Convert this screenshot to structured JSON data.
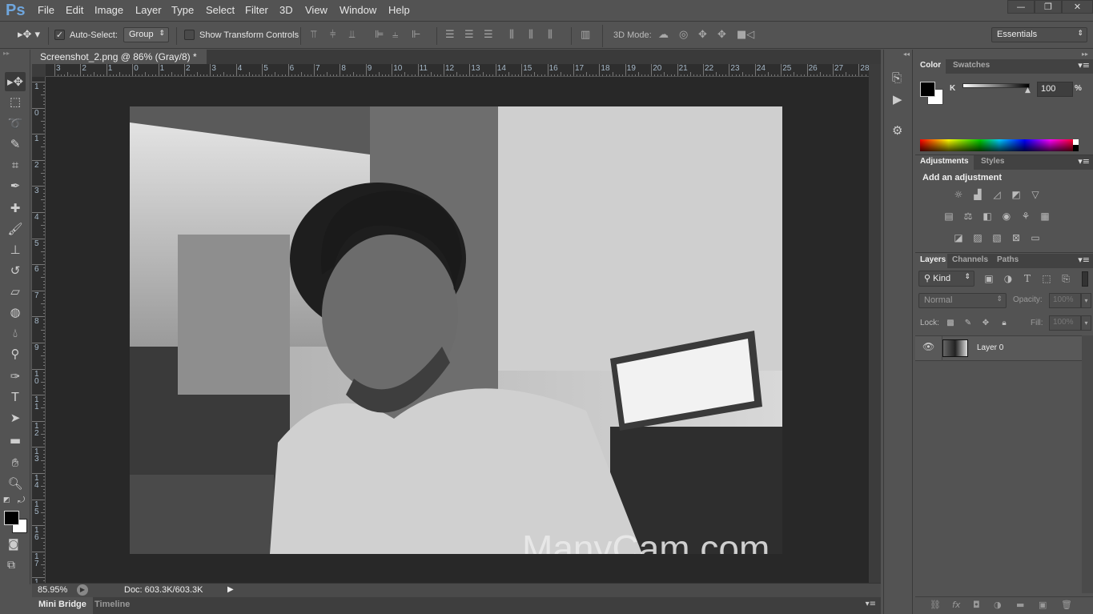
{
  "app": {
    "logo": "Ps"
  },
  "menu": [
    "File",
    "Edit",
    "Image",
    "Layer",
    "Type",
    "Select",
    "Filter",
    "3D",
    "View",
    "Window",
    "Help"
  ],
  "window_controls": {
    "minimize": "—",
    "restore": "❐",
    "close": "✕"
  },
  "options": {
    "auto_select_label": "Auto-Select:",
    "auto_select_checked": true,
    "auto_select_value": "Group",
    "transform_label": "Show Transform Controls",
    "transform_checked": false,
    "mode3d_label": "3D Mode:",
    "workspace": "Essentials"
  },
  "document": {
    "tab_title": "Screenshot_2.png @ 86% (Gray/8) *",
    "close": "×"
  },
  "rulers": {
    "top": [
      "3",
      "2",
      "1",
      "0",
      "1",
      "2",
      "3",
      "4",
      "5",
      "6",
      "7",
      "8",
      "9",
      "10",
      "11",
      "12",
      "13",
      "14",
      "15",
      "16",
      "17",
      "18",
      "19",
      "20",
      "21",
      "22",
      "23",
      "24",
      "25",
      "26",
      "27",
      "28"
    ],
    "left": [
      "1",
      "0",
      "1",
      "2",
      "3",
      "4",
      "5",
      "6",
      "7",
      "8",
      "9",
      "10",
      "11",
      "12",
      "13",
      "14",
      "15",
      "16",
      "17",
      "1"
    ]
  },
  "tools": [
    "move",
    "rectangular-marquee",
    "lasso",
    "quick-selection",
    "crop",
    "eyedropper",
    "spot-healing",
    "brush",
    "clone-stamp",
    "history-brush",
    "eraser",
    "paint-bucket",
    "blur",
    "dodge",
    "pen",
    "type",
    "path-selection",
    "rectangle",
    "hand",
    "zoom"
  ],
  "status": {
    "zoom": "85.95%",
    "doc": "Doc: 603.3K/603.3K"
  },
  "bottom_tabs": [
    "Mini Bridge",
    "Timeline"
  ],
  "color_panel": {
    "tabs": [
      "Color",
      "Swatches"
    ],
    "channel": "K",
    "value": "100",
    "unit": "%",
    "foreground": "#000000",
    "background": "#ffffff"
  },
  "adjustments_panel": {
    "tabs": [
      "Adjustments",
      "Styles"
    ],
    "heading": "Add an adjustment"
  },
  "layers_panel": {
    "tabs": [
      "Layers",
      "Channels",
      "Paths"
    ],
    "filter": "Kind",
    "blend_mode": "Normal",
    "opacity_label": "Opacity:",
    "opacity": "100%",
    "lock_label": "Lock:",
    "fill_label": "Fill:",
    "fill": "100%",
    "layers": [
      {
        "name": "Layer 0",
        "visible": true
      }
    ]
  }
}
